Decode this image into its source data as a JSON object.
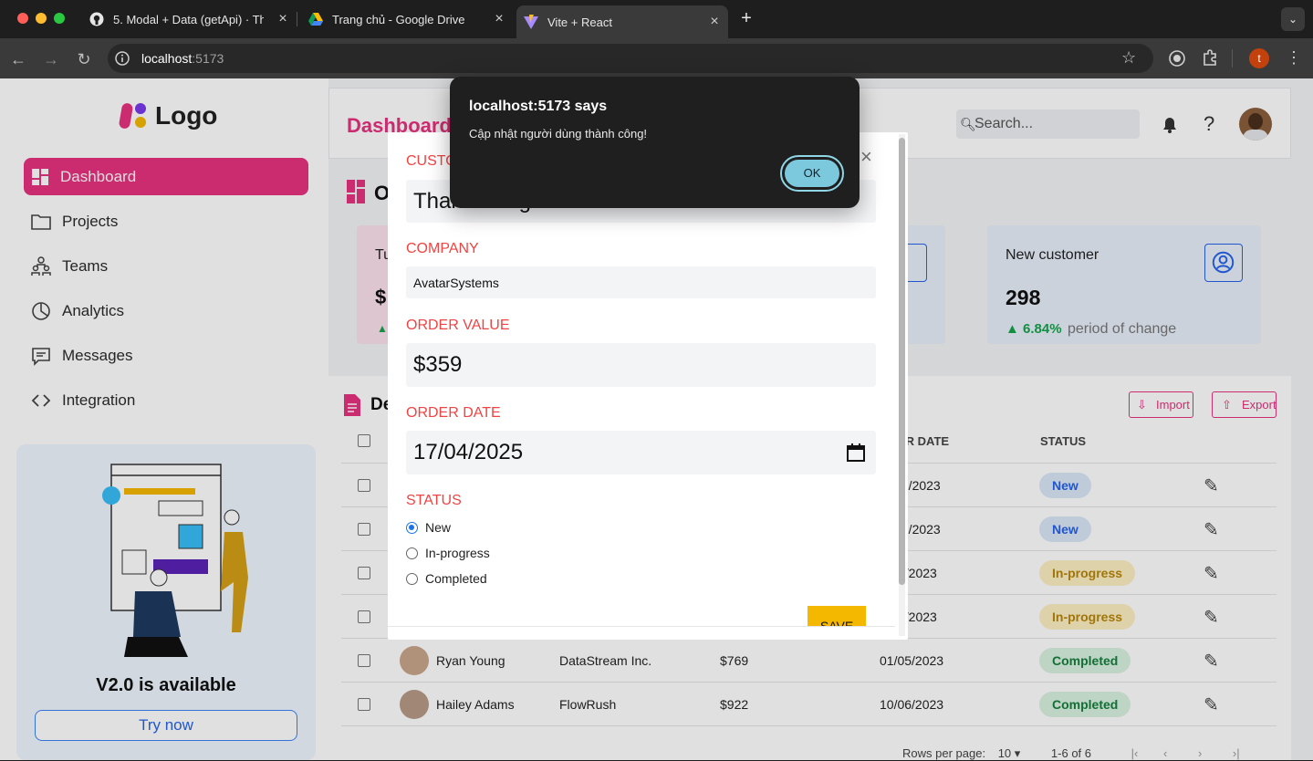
{
  "browser": {
    "tabs": [
      {
        "title": "5. Modal + Data (getApi) · Tha",
        "icon": "github-icon"
      },
      {
        "title": "Trang chủ - Google Drive",
        "icon": "google-drive-icon"
      },
      {
        "title": "Vite + React",
        "icon": "vite-icon",
        "active": true
      }
    ],
    "url_host": "localhost",
    "url_port": ":5173",
    "profile_initial": "t"
  },
  "sidebar": {
    "logo_text": "Logo",
    "items": [
      {
        "label": "Dashboard",
        "icon": "dashboard-icon",
        "active": true
      },
      {
        "label": "Projects",
        "icon": "folder-icon"
      },
      {
        "label": "Teams",
        "icon": "teams-icon"
      },
      {
        "label": "Analytics",
        "icon": "chart-pie-icon"
      },
      {
        "label": "Messages",
        "icon": "message-icon"
      },
      {
        "label": "Integration",
        "icon": "code-icon"
      }
    ],
    "promo_title": "V2.0 is available",
    "promo_button": "Try now"
  },
  "header": {
    "title": "Dashboard",
    "search_placeholder": "Search..."
  },
  "overview": {
    "title_partial": "O",
    "card1_label": "Tu",
    "card1_value": "$",
    "card3": {
      "label": "New customer",
      "value": "298",
      "change": "6.84%",
      "change_note": "period of change"
    }
  },
  "table": {
    "title_partial": "De",
    "import_label": "Import",
    "export_label": "Export",
    "headers": {
      "date": "ER DATE",
      "status": "STATUS"
    },
    "rows": [
      {
        "name": "",
        "company": "",
        "value": "",
        "date": "/7/2023",
        "status": "New"
      },
      {
        "name": "",
        "company": "",
        "value": "",
        "date": "/7/2023",
        "status": "New"
      },
      {
        "name": "",
        "company": "",
        "value": "",
        "date": "3/2023",
        "status": "In-progress"
      },
      {
        "name": "",
        "company": "",
        "value": "",
        "date": "3/2023",
        "status": "In-progress"
      },
      {
        "name": "Ryan Young",
        "company": "DataStream Inc.",
        "value": "$769",
        "date": "01/05/2023",
        "status": "Completed"
      },
      {
        "name": "Hailey Adams",
        "company": "FlowRush",
        "value": "$922",
        "date": "10/06/2023",
        "status": "Completed"
      }
    ],
    "footer": {
      "rows_per_page_label": "Rows per page:",
      "rows_per_page": "10",
      "range": "1-6 of 6"
    }
  },
  "modal": {
    "customer_label": "CUSTO",
    "customer_value": "Thanh Tùng",
    "company_label": "COMPANY",
    "company_value": "AvatarSystems",
    "order_value_label": "ORDER VALUE",
    "order_value": "$359",
    "order_date_label": "ORDER DATE",
    "order_date": "17/04/2025",
    "status_label": "STATUS",
    "status_options": [
      "New",
      "In-progress",
      "Completed"
    ],
    "status_selected": "New",
    "save_label": "SAVE"
  },
  "alert": {
    "title": "localhost:5173 says",
    "message": "Cập nhật người dùng thành công!",
    "ok_label": "OK"
  },
  "colors": {
    "accent": "#e8317f",
    "badge_new_bg": "#dbe7f7",
    "badge_new_fg": "#2563eb",
    "badge_progress_bg": "#fdf0c2",
    "badge_progress_fg": "#b8860b",
    "badge_done_bg": "#d9f2e0",
    "badge_done_fg": "#15803d",
    "save_button": "#f5b800"
  }
}
